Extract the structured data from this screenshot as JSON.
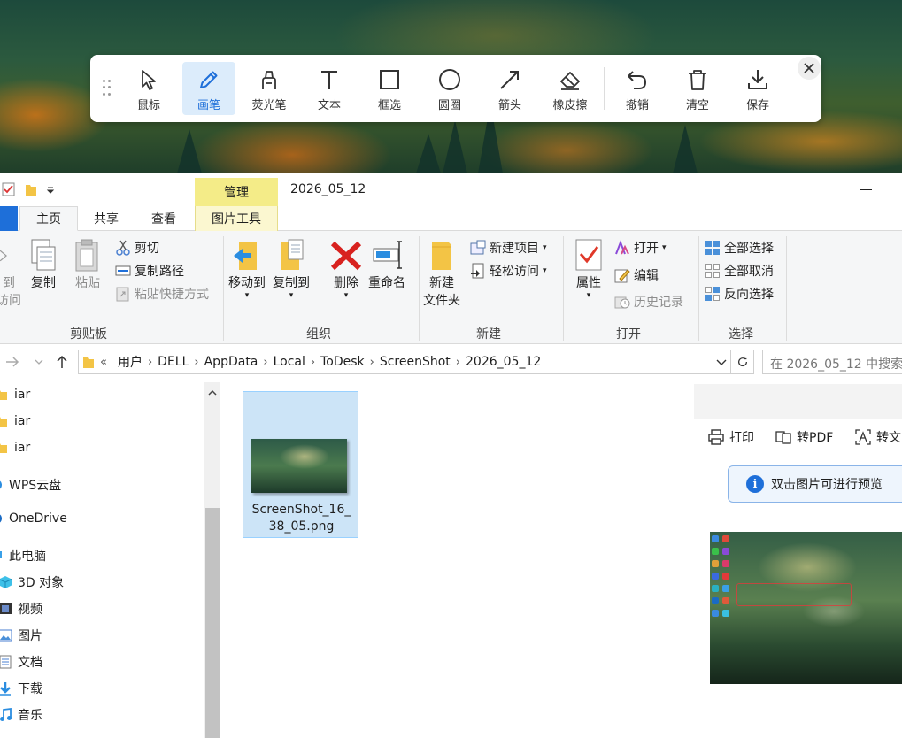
{
  "toolbar": {
    "tools": [
      {
        "label": "鼠标",
        "icon": "cursor-icon"
      },
      {
        "label": "画笔",
        "icon": "pen-icon",
        "active": true
      },
      {
        "label": "荧光笔",
        "icon": "highlighter-icon"
      },
      {
        "label": "文本",
        "icon": "text-icon"
      },
      {
        "label": "框选",
        "icon": "rectangle-icon"
      },
      {
        "label": "圆圈",
        "icon": "circle-icon"
      },
      {
        "label": "箭头",
        "icon": "arrow-icon"
      },
      {
        "label": "橡皮擦",
        "icon": "eraser-icon"
      },
      {
        "label": "撤销",
        "icon": "undo-icon"
      },
      {
        "label": "清空",
        "icon": "trash-icon"
      },
      {
        "label": "保存",
        "icon": "download-icon"
      }
    ]
  },
  "explorer": {
    "title": "2026_05_12",
    "manage_tab": "管理",
    "tabs": {
      "home": "主页",
      "share": "共享",
      "view": "查看",
      "picture_tools": "图片工具"
    },
    "ribbon": {
      "clipboard": {
        "pin_line1": "到",
        "pin_line2": "访问",
        "copy": "复制",
        "paste": "粘贴",
        "cut": "剪切",
        "copy_path": "复制路径",
        "paste_shortcut": "粘贴快捷方式",
        "label": "剪贴板"
      },
      "organize": {
        "move_to": "移动到",
        "copy_to": "复制到",
        "delete": "删除",
        "rename": "重命名",
        "label": "组织"
      },
      "new": {
        "new_folder_line1": "新建",
        "new_folder_line2": "文件夹",
        "new_item": "新建项目",
        "easy_access": "轻松访问",
        "label": "新建"
      },
      "open": {
        "properties": "属性",
        "open": "打开",
        "edit": "编辑",
        "history": "历史记录",
        "label": "打开"
      },
      "select": {
        "select_all": "全部选择",
        "select_none": "全部取消",
        "invert": "反向选择",
        "label": "选择"
      }
    },
    "address": {
      "prefix": "«",
      "crumbs": [
        "用户",
        "DELL",
        "AppData",
        "Local",
        "ToDesk",
        "ScreenShot",
        "2026_05_12"
      ],
      "search_placeholder": "在 2026_05_12 中搜索"
    },
    "nav": [
      {
        "label": "iar",
        "icon": "folder-icon"
      },
      {
        "label": "iar",
        "icon": "folder-icon"
      },
      {
        "label": "iar",
        "icon": "folder-icon"
      },
      {
        "label": "WPS云盘",
        "icon": "cloud-icon"
      },
      {
        "label": "OneDrive",
        "icon": "onedrive-icon"
      },
      {
        "label": "此电脑",
        "icon": "computer-icon"
      },
      {
        "label": "3D 对象",
        "icon": "cube-icon"
      },
      {
        "label": "视频",
        "icon": "video-icon"
      },
      {
        "label": "图片",
        "icon": "picture-icon"
      },
      {
        "label": "文档",
        "icon": "document-icon"
      },
      {
        "label": "下载",
        "icon": "download-icon"
      },
      {
        "label": "音乐",
        "icon": "music-icon"
      }
    ],
    "file": {
      "name_line1": "ScreenShot_16_",
      "name_line2": "38_05.png"
    },
    "preview": {
      "print": "打印",
      "to_pdf": "转PDF",
      "to_text": "转文",
      "hint": "双击图片可进行预览"
    }
  }
}
